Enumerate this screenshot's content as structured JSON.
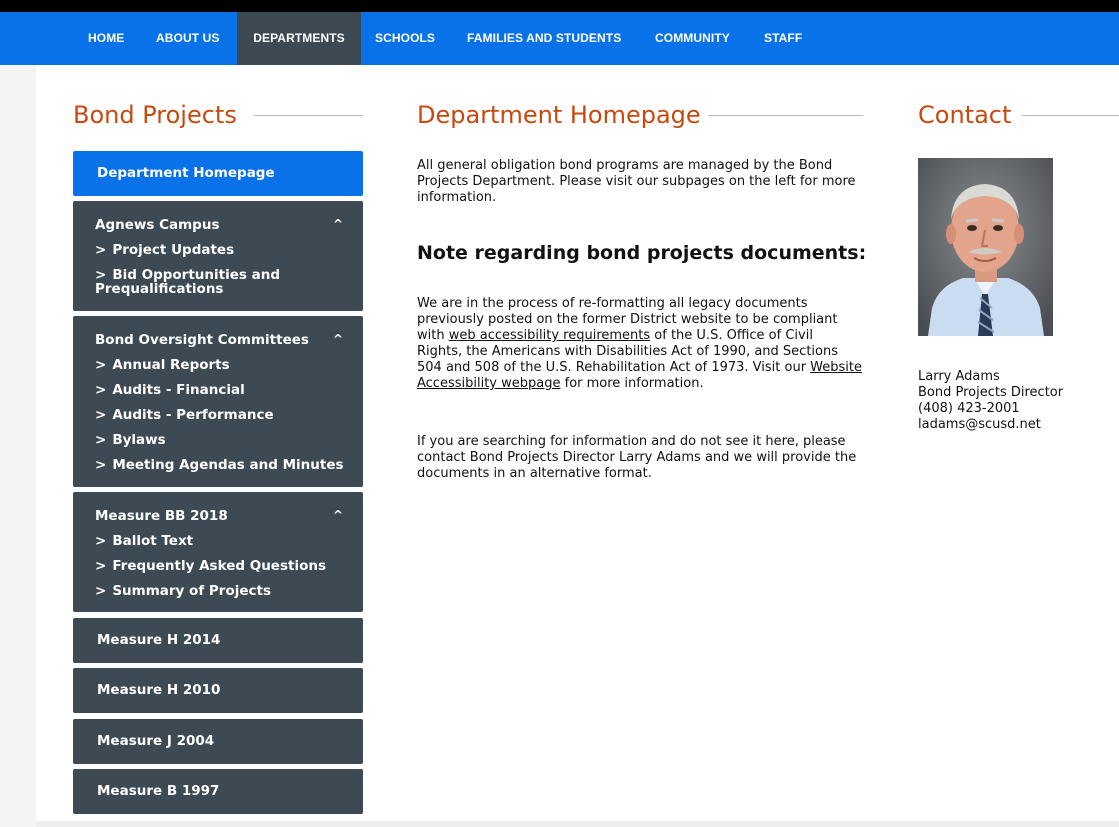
{
  "nav": {
    "items": [
      {
        "label": "Home"
      },
      {
        "label": "About Us"
      },
      {
        "label": "Departments"
      },
      {
        "label": "Schools"
      },
      {
        "label": "Families and Students"
      },
      {
        "label": "Community"
      },
      {
        "label": "Staff"
      }
    ],
    "active": "Departments"
  },
  "sidebar": {
    "title": "Bond Projects",
    "home_label": "Department Homepage",
    "groups": [
      {
        "title": "Agnews Campus",
        "caret": "^",
        "items": [
          "Project Updates",
          "Bid Opportunities and Prequalifications"
        ]
      },
      {
        "title": "Bond Oversight Committees",
        "caret": "^",
        "items": [
          "Annual Reports",
          "Audits - Financial",
          "Audits - Performance",
          "Bylaws",
          "Meeting Agendas and Minutes"
        ]
      },
      {
        "title": "Measure BB 2018",
        "caret": "^",
        "items": [
          "Ballot Text",
          "Frequently Asked Questions",
          "Summary of Projects"
        ]
      }
    ],
    "singles": [
      "Measure H 2014",
      "Measure H 2010",
      "Measure J 2004",
      "Measure B 1997"
    ],
    "chevron": ">"
  },
  "main": {
    "title": "Department Homepage",
    "intro": "All general obligation bond programs are managed by the Bond Projects Department. Please visit our subpages on the left for more information.",
    "note_heading": "Note regarding bond projects documents:",
    "para2_a": "We are in the process of re-formatting all legacy documents previously posted on the former District website to be compliant with ",
    "para2_link1": "web accessibility requirements",
    "para2_b": " of the U.S. Office of Civil Rights, the Americans with Disabilities Act of 1990, and Sections 504 and 508 of the U.S. Rehabilitation Act of 1973. Visit our ",
    "para2_link2": "Website Accessibility webpage",
    "para2_c": " for more information.",
    "para3": "If you are searching for information and do not see it here, please contact Bond Projects Director Larry Adams and we will provide the documents in an alternative format."
  },
  "contact": {
    "title": "Contact",
    "name": "Larry Adams",
    "role": "Bond Projects Director",
    "phone": "(408) 423-2001",
    "email": "ladams@scusd.net"
  },
  "colors": {
    "nav_blue": "#0a72e8",
    "tile_dark": "#3d4953",
    "heading_orange": "#c64a10"
  }
}
